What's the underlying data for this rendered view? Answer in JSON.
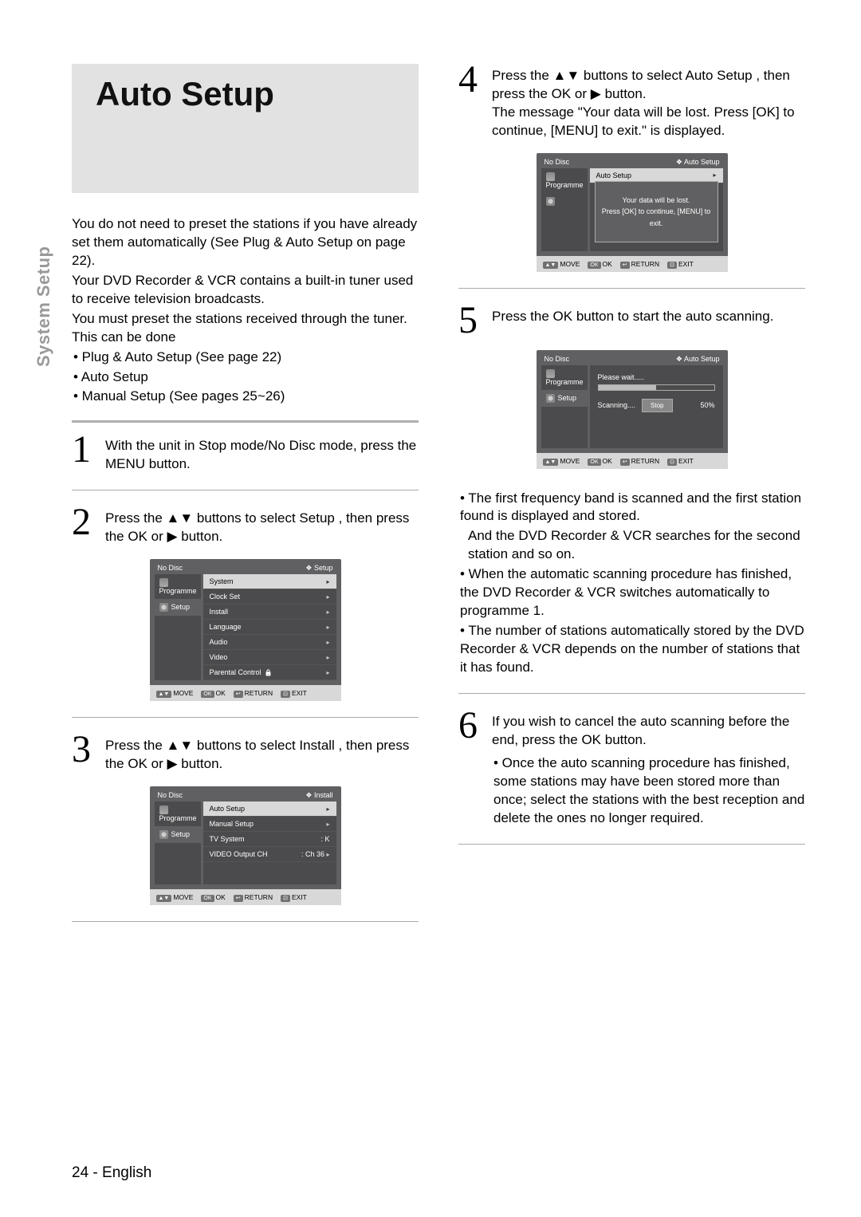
{
  "sideTab": "System Setup",
  "title": "Auto Setup",
  "intro": {
    "p1": "You do not need to preset the stations if you have already set them automatically (See Plug & Auto Setup on page 22).",
    "p2": "Your DVD Recorder & VCR contains a built-in tuner used to receive television broadcasts.",
    "p3": "You must preset the stations received through the tuner. This can be done",
    "b1": "• Plug & Auto Setup (See page 22)",
    "b2": "• Auto Setup",
    "b3": "• Manual Setup (See pages 25~26)"
  },
  "steps": {
    "s1": "With the unit in Stop mode/No Disc mode, press the MENU button.",
    "s2": "Press the ▲▼ buttons to select Setup , then press the OK or ▶ button.",
    "s3": "Press the ▲▼ buttons to select Install , then press the OK or ▶ button.",
    "s4a": "Press the ▲▼ buttons to select Auto Setup , then press the OK or ▶ button.",
    "s4b": "The message \"Your data will be lost. Press [OK] to continue, [MENU] to exit.\" is displayed.",
    "s5": "Press the OK button to start the auto scanning.",
    "s5b1": "• The first frequency band is scanned and the first station found is displayed and stored.",
    "s5b1b": "And the DVD Recorder & VCR searches for the second station and so on.",
    "s5b2": "• When the automatic scanning procedure has finished, the DVD Recorder & VCR switches automatically to programme 1.",
    "s5b3": "• The number of stations automatically stored by the DVD Recorder & VCR depends on the number of stations that it has found.",
    "s6a": "If you wish to cancel the auto scanning before the end, press the OK button.",
    "s6b": "• Once the auto scanning procedure has finished, some stations may have been stored more than once; select the stations with the best reception and delete the ones no longer required."
  },
  "osd": {
    "noDisc": "No Disc",
    "breadcrumbSetup": "❖ Setup",
    "breadcrumbInstall": "❖   Install",
    "breadcrumbAuto": "❖   Auto Setup",
    "leftProgramme": "Programme",
    "leftSetup": "Setup",
    "rowsSetup": {
      "system": "System",
      "clock": "Clock Set",
      "install": "Install",
      "language": "Language",
      "audio": "Audio",
      "video": "Video",
      "parental": "Parental Control"
    },
    "rowsInstall": {
      "auto": "Auto Setup",
      "manual": "Manual Setup",
      "tvsys": "TV System",
      "tvsysVal": ": K",
      "videoOut": "VIDEO Output CH",
      "videoOutVal": ": Ch 36"
    },
    "autoHeader": "Auto Setup",
    "msg1": "Your data will be lost.",
    "msg2": "Press [OK] to continue, [MENU] to exit.",
    "scan": {
      "wait": "Please wait.....",
      "scanning": "Scanning....",
      "stop": "Stop",
      "pct": "50%"
    },
    "footer": {
      "move": "MOVE",
      "ok": "OK",
      "return": "RETURN",
      "exit": "EXIT"
    }
  },
  "footer": "24 - English"
}
